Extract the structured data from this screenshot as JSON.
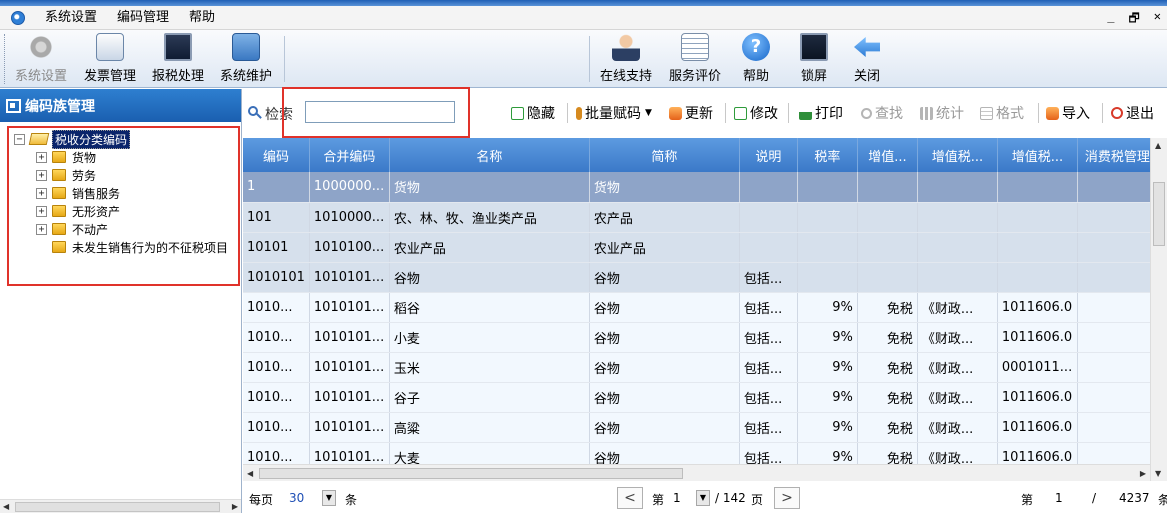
{
  "menu": [
    "系统设置",
    "编码管理",
    "帮助"
  ],
  "window_controls": [
    "_",
    "🗗",
    "✕"
  ],
  "toolbar_left": [
    {
      "label": "系统设置",
      "icon": "gear-icon",
      "disabled": true
    },
    {
      "label": "发票管理",
      "icon": "invoice-icon",
      "disabled": false
    },
    {
      "label": "报税处理",
      "icon": "monitor-icon",
      "disabled": false
    },
    {
      "label": "系统维护",
      "icon": "folder-gear-icon",
      "disabled": false
    }
  ],
  "toolbar_right": [
    {
      "label": "在线支持",
      "icon": "support-person-icon"
    },
    {
      "label": "服务评价",
      "icon": "rating-document-icon"
    },
    {
      "label": "帮助",
      "icon": "help-icon"
    },
    {
      "label": "锁屏",
      "icon": "lock-screen-icon"
    },
    {
      "label": "关闭",
      "icon": "close-arrow-icon"
    }
  ],
  "left_panel": {
    "title": "编码族管理",
    "tree": {
      "root": "税收分类编码",
      "children": [
        "货物",
        "劳务",
        "销售服务",
        "无形资产",
        "不动产",
        "未发生销售行为的不征税项目"
      ]
    }
  },
  "search": {
    "label": "检索",
    "value": ""
  },
  "actions": [
    {
      "label": "隐藏",
      "icon": "hide-icon",
      "disabled": false
    },
    {
      "label": "批量赋码",
      "icon": "batch-code-icon",
      "disabled": false,
      "dropdown": true
    },
    {
      "label": "更新",
      "icon": "update-icon",
      "disabled": false
    },
    {
      "label": "修改",
      "icon": "edit-icon",
      "disabled": false
    },
    {
      "label": "打印",
      "icon": "print-icon",
      "disabled": false
    },
    {
      "label": "查找",
      "icon": "find-icon",
      "disabled": true
    },
    {
      "label": "统计",
      "icon": "stats-icon",
      "disabled": true
    },
    {
      "label": "格式",
      "icon": "format-icon",
      "disabled": true
    },
    {
      "label": "导入",
      "icon": "import-icon",
      "disabled": false
    },
    {
      "label": "退出",
      "icon": "power-icon",
      "disabled": false
    }
  ],
  "table": {
    "columns": [
      "编码",
      "合并编码",
      "名称",
      "简称",
      "说明",
      "税率",
      "增值...",
      "增值税...",
      "增值税...",
      "消费税管理"
    ],
    "rows": [
      {
        "style": "sel",
        "cells": [
          "1",
          "1000000...",
          "货物",
          "货物",
          "",
          "",
          "",
          "",
          "",
          ""
        ]
      },
      {
        "style": "lvl",
        "cells": [
          "101",
          "1010000...",
          "农、林、牧、渔业类产品",
          "农产品",
          "",
          "",
          "",
          "",
          "",
          ""
        ]
      },
      {
        "style": "lvl",
        "cells": [
          "10101",
          "1010100...",
          "农业产品",
          "农业产品",
          "",
          "",
          "",
          "",
          "",
          ""
        ]
      },
      {
        "style": "lvl",
        "cells": [
          "1010101",
          "1010101...",
          "谷物",
          "谷物",
          "包括...",
          "",
          "",
          "",
          "",
          ""
        ]
      },
      {
        "style": "leaf",
        "cells": [
          "1010...",
          "1010101...",
          "稻谷",
          "谷物",
          "包括...",
          "9%",
          "免税",
          "《财政...",
          "1011606.0",
          ""
        ]
      },
      {
        "style": "leaf",
        "cells": [
          "1010...",
          "1010101...",
          "小麦",
          "谷物",
          "包括...",
          "9%",
          "免税",
          "《财政...",
          "1011606.0",
          ""
        ]
      },
      {
        "style": "leaf",
        "cells": [
          "1010...",
          "1010101...",
          "玉米",
          "谷物",
          "包括...",
          "9%",
          "免税",
          "《财政...",
          "0001011...",
          ""
        ]
      },
      {
        "style": "leaf",
        "cells": [
          "1010...",
          "1010101...",
          "谷子",
          "谷物",
          "包括...",
          "9%",
          "免税",
          "《财政...",
          "1011606.0",
          ""
        ]
      },
      {
        "style": "leaf",
        "cells": [
          "1010...",
          "1010101...",
          "高粱",
          "谷物",
          "包括...",
          "9%",
          "免税",
          "《财政...",
          "1011606.0",
          ""
        ]
      },
      {
        "style": "leaf",
        "cells": [
          "1010...",
          "1010101...",
          "大麦",
          "谷物",
          "包括...",
          "9%",
          "免税",
          "《财政...",
          "1011606.0",
          ""
        ]
      }
    ]
  },
  "pager": {
    "per_page_label": "每页",
    "per_page_value": "30",
    "unit": "条",
    "page_prefix": "第",
    "current_page": "1",
    "total_pages": "/ 142",
    "page_unit": "页",
    "record_prefix": "第",
    "record_current": "1",
    "record_sep": "/",
    "record_total": "4237",
    "record_unit": "条"
  }
}
